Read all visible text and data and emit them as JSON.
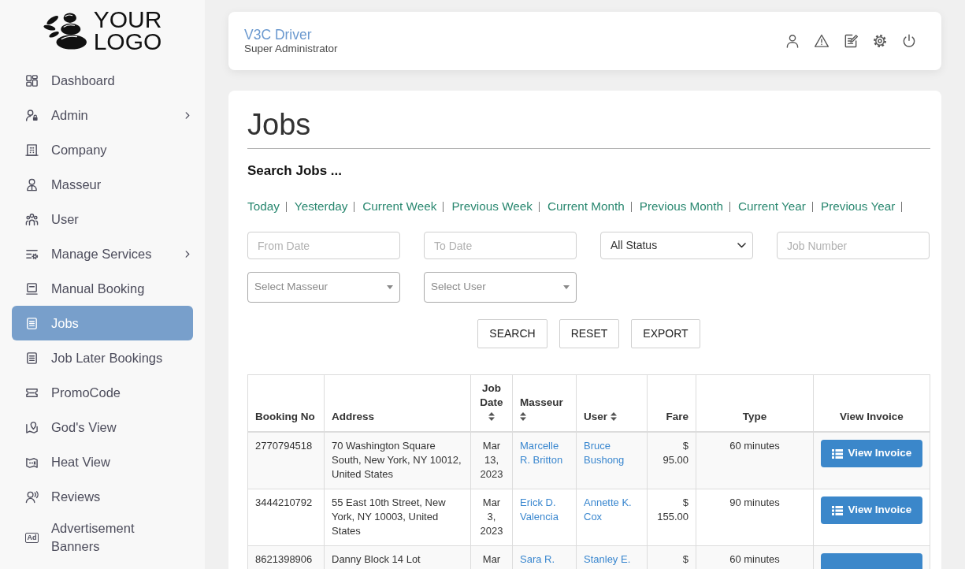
{
  "sidebar": {
    "logo": {
      "text": "YOUR LOGO"
    },
    "items": [
      {
        "label": "Dashboard",
        "selected": false,
        "submenu": false
      },
      {
        "label": "Admin",
        "selected": false,
        "submenu": true
      },
      {
        "label": "Company",
        "selected": false,
        "submenu": false
      },
      {
        "label": "Masseur",
        "selected": false,
        "submenu": false
      },
      {
        "label": "User",
        "selected": false,
        "submenu": false
      },
      {
        "label": "Manage Services",
        "selected": false,
        "submenu": true
      },
      {
        "label": "Manual Booking",
        "selected": false,
        "submenu": false
      },
      {
        "label": "Jobs",
        "selected": true,
        "submenu": false
      },
      {
        "label": "Job Later Bookings",
        "selected": false,
        "submenu": false
      },
      {
        "label": "PromoCode",
        "selected": false,
        "submenu": false
      },
      {
        "label": "God's View",
        "selected": false,
        "submenu": false
      },
      {
        "label": "Heat View",
        "selected": false,
        "submenu": false
      },
      {
        "label": "Reviews",
        "selected": false,
        "submenu": false
      },
      {
        "label": "Advertisement Banners",
        "selected": false,
        "submenu": false,
        "icon_text": "Ad"
      }
    ]
  },
  "header": {
    "title": "V3C Driver",
    "subtitle": "Super Administrator"
  },
  "page": {
    "title": "Jobs",
    "search_heading": "Search Jobs ...",
    "quick_filters": [
      "Today",
      "Yesterday",
      "Current Week",
      "Previous Week",
      "Current Month",
      "Previous Month",
      "Current Year",
      "Previous Year"
    ],
    "filters": [
      {
        "kind": "text",
        "placeholder": "From Date"
      },
      {
        "kind": "text",
        "placeholder": "To Date"
      },
      {
        "kind": "select",
        "value": "All Status"
      },
      {
        "kind": "text",
        "placeholder": "Job Number"
      },
      {
        "kind": "search-select",
        "placeholder": "Select Masseur"
      },
      {
        "kind": "search-select",
        "placeholder": "Select User"
      }
    ],
    "buttons": [
      "SEARCH",
      "RESET",
      "EXPORT"
    ]
  },
  "table": {
    "columns": [
      {
        "label": "Booking No",
        "sortable": false
      },
      {
        "label": "Address",
        "sortable": false
      },
      {
        "label": "Job Date",
        "sortable": true
      },
      {
        "label": "Masseur",
        "sortable": true
      },
      {
        "label": "User",
        "sortable": true
      },
      {
        "label": "Fare",
        "sortable": false
      },
      {
        "label": "Type",
        "sortable": false
      },
      {
        "label": "View Invoice",
        "sortable": false
      }
    ],
    "rows": [
      {
        "booking_no": "2770794518",
        "address": "70 Washington Square South, New York, NY 10012, United States",
        "job_date": "Mar 13, 2023",
        "masseur": "Marcelle R. Britton",
        "user": "Bruce Bushong",
        "fare": "$ 95.00",
        "type": "60 minutes",
        "invoice": "View Invoice"
      },
      {
        "booking_no": "3444210792",
        "address": "55 East 10th Street, New York, NY 10003, United States",
        "job_date": "Mar 3, 2023",
        "masseur": "Erick D. Valencia",
        "user": "Annette K. Cox",
        "fare": "$ 155.00",
        "type": "90 minutes",
        "invoice": "View Invoice"
      },
      {
        "booking_no": "8621398906",
        "address": "Danny Block 14 Lot",
        "job_date": "Mar",
        "masseur": "Sara R.",
        "user": "Stanley E.",
        "fare": "$",
        "type": "60 minutes"
      }
    ]
  }
}
